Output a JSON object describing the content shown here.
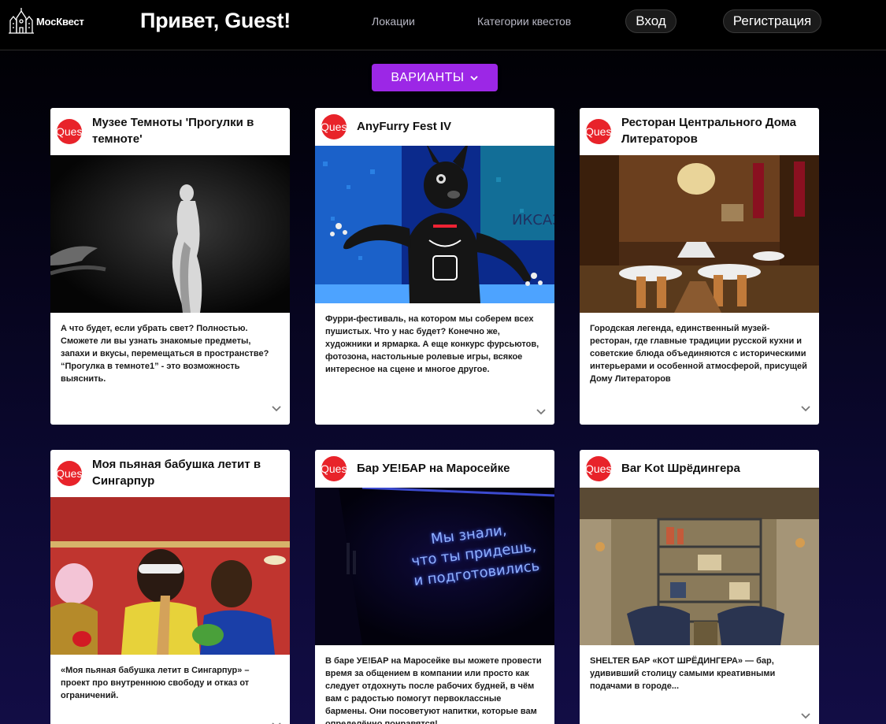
{
  "header": {
    "logo_text": "МосКвест",
    "greeting": "Привет, Guest!",
    "nav": [
      "Локации",
      "Категории квестов"
    ],
    "login_label": "Вход",
    "register_label": "Регистрация"
  },
  "variants_label": "ВАРИАНТЫ",
  "badge_text": "Quest",
  "colors": {
    "accent": "#9c27e6",
    "badge": "#e8232a",
    "header_bg": "#000000",
    "card_bg": "#ffffff"
  },
  "cards": [
    {
      "title": "Музее Темноты 'Прогулки в темноте'",
      "description": "А что будет, если убрать свет? Полностью. Сможете ли вы узнать знакомые предметы, запахи и вкусы, перемещаться в пространстве? “Прогулка в темноте1” - это возможность выяснить."
    },
    {
      "title": "AnyFurry Fest IV",
      "description": "Фурри-фестиваль, на котором мы соберем всех пушистых. Что у нас будет? Конечно же, художники и ярмарка. А еще конкурс фурсьютов, фотозона, настольные ролевые игры, всякое интересное на сцене и многое другое."
    },
    {
      "title": "Ресторан Центрального Дома Литераторов",
      "description": "Городская легенда, единственный музей-ресторан, где главные традиции русской кухни и советские блюда объединяются с историческими интерьерами и особенной атмосферой, присущей Дому Литераторов"
    },
    {
      "title": "Моя пьяная бабушка летит в Сингарпур",
      "description": "«Моя пьяная бабушка летит в Сингарпур» – проект про внутреннюю свободу и отказ от ограничений."
    },
    {
      "title": "Бар УЕ!БАР на Маросейке",
      "description": "В баре УЕ!БАР на Маросейке вы можете провести время за общением в компании или просто как следует отдохнуть после рабочих будней, в чём вам с радостью помогут первоклассные бармены. Они посоветуют напитки, которые вам определённо понравятся!",
      "neon_text": [
        "Мы знали,",
        "что ты придешь,",
        "и подготовились"
      ]
    },
    {
      "title": "Bar Kot Шрёдингера",
      "description": "SHELTER БАР «КОТ ШРЁДИНГЕРА» — бар, удививший столицу самыми креативными подачами в городе..."
    }
  ]
}
